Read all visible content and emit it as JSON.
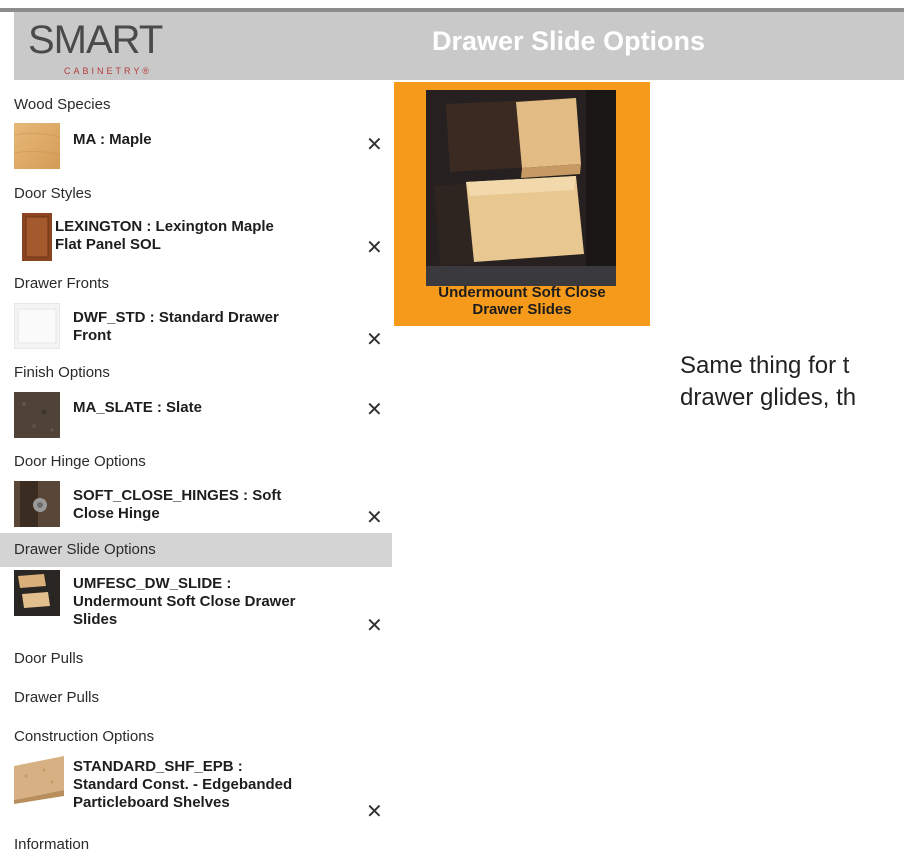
{
  "header": {
    "logo_text": "SMART",
    "logo_sub": "CABINETRY",
    "logo_reg": "®",
    "title": "Drawer Slide Options"
  },
  "sidebar": {
    "sections": [
      {
        "label": "Wood Species"
      },
      {
        "label": "Door Styles"
      },
      {
        "label": "Drawer Fronts"
      },
      {
        "label": "Finish Options"
      },
      {
        "label": "Door Hinge Options"
      },
      {
        "label": "Drawer Slide Options",
        "active": true
      },
      {
        "label": "Door Pulls"
      },
      {
        "label": "Drawer Pulls"
      },
      {
        "label": "Construction Options"
      },
      {
        "label": "Information"
      }
    ],
    "items": [
      {
        "line1": "MA : Maple",
        "line2": "",
        "line3": ""
      },
      {
        "line1": "LEXINGTON : Lexington Maple",
        "line2": "Flat Panel SOL",
        "line3": ""
      },
      {
        "line1": "DWF_STD : Standard Drawer",
        "line2": "Front",
        "line3": ""
      },
      {
        "line1": "MA_SLATE : Slate",
        "line2": "",
        "line3": ""
      },
      {
        "line1": "SOFT_CLOSE_HINGES : Soft",
        "line2": "Close Hinge",
        "line3": ""
      },
      {
        "line1": "UMFESC_DW_SLIDE :",
        "line2": "Undermount Soft Close Drawer",
        "line3": "Slides"
      },
      {
        "line1": "STANDARD_SHF_EPB :",
        "line2": "Standard Const. - Edgebanded",
        "line3": "Particleboard Shelves"
      }
    ],
    "remove_glyph": "✕"
  },
  "option": {
    "caption_line1": "Undermount Soft Close",
    "caption_line2": "Drawer Slides",
    "accent": "#f59a1b"
  },
  "note": {
    "line1": "Same thing for t",
    "line2": "drawer glides, th"
  }
}
